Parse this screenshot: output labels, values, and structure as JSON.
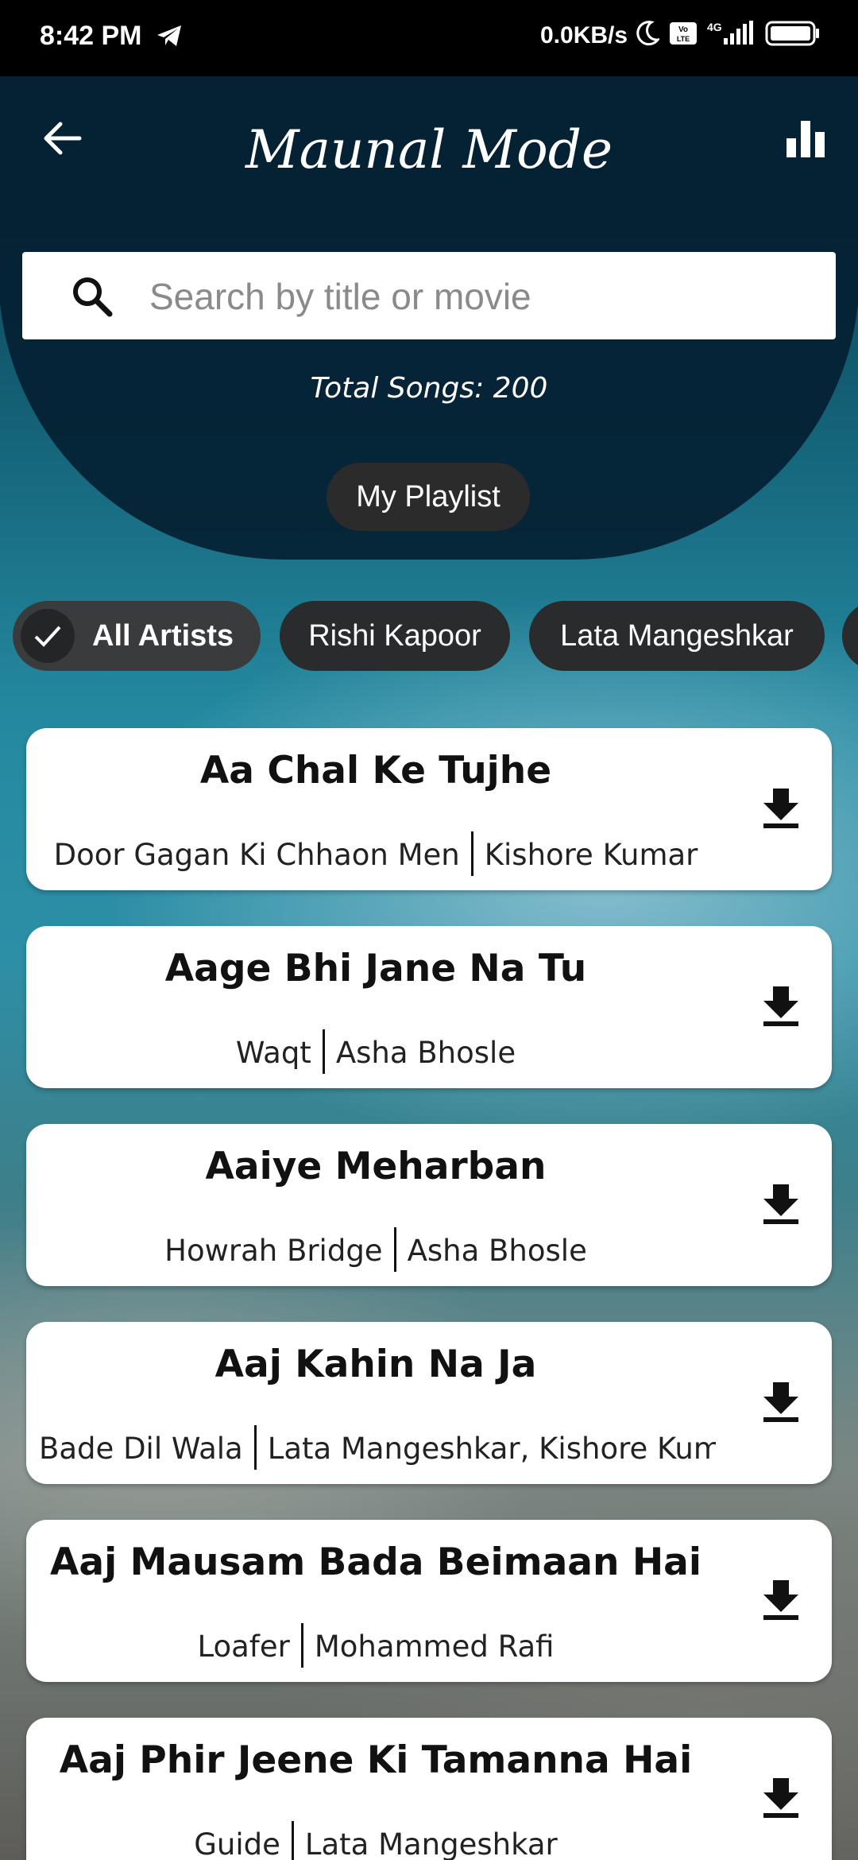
{
  "status_bar": {
    "time": "8:42 PM",
    "speed": "0.0KB/s",
    "network": "4G"
  },
  "header": {
    "title": "Maunal Mode"
  },
  "search": {
    "placeholder": "Search by title or movie",
    "value": ""
  },
  "total_songs": "Total Songs: 200",
  "my_playlist_label": "My Playlist",
  "artist_chips": [
    {
      "label": "All Artists",
      "selected": true
    },
    {
      "label": "Rishi Kapoor",
      "selected": false
    },
    {
      "label": "Lata Mangeshkar",
      "selected": false
    }
  ],
  "songs": [
    {
      "title": "Aa Chal Ke Tujhe",
      "movie": "Door Gagan Ki Chhaon Men",
      "artist": "Kishore Kumar"
    },
    {
      "title": "Aage Bhi Jane Na Tu",
      "movie": "Waqt",
      "artist": "Asha Bhosle"
    },
    {
      "title": "Aaiye Meharban",
      "movie": "Howrah Bridge",
      "artist": "Asha Bhosle"
    },
    {
      "title": "Aaj Kahin Na Ja",
      "movie": "Bade Dil Wala",
      "artist": "Lata Mangeshkar, Kishore Kumar"
    },
    {
      "title": "Aaj Mausam Bada Beimaan Hai",
      "movie": "Loafer",
      "artist": "Mohammed Rafi"
    },
    {
      "title": "Aaj Phir Jeene Ki Tamanna Hai",
      "movie": "Guide",
      "artist": "Lata Mangeshkar"
    }
  ],
  "icons": {
    "back": "arrow-left-icon",
    "stats": "bar-chart-icon",
    "search": "search-icon",
    "check": "check-icon",
    "download": "download-icon"
  },
  "colors": {
    "header_bg": "#042032",
    "chip_bg": "#2a2b2c",
    "card_bg": "#ffffff"
  }
}
